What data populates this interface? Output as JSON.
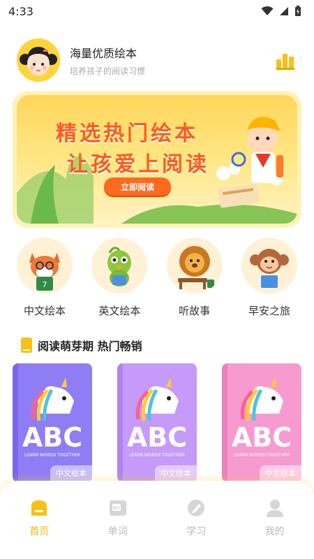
{
  "status_bar": {
    "time": "4:33"
  },
  "header": {
    "title": "海量优质绘本",
    "subtitle": "培养孩子的阅读习惯"
  },
  "banner": {
    "line1": "精选热门绘本",
    "line2": "让孩爱上阅读",
    "button": "立即阅读"
  },
  "categories": [
    {
      "label": "中文绘本",
      "icon": "fox-reading-icon"
    },
    {
      "label": "英文绘本",
      "icon": "parrot-reading-icon"
    },
    {
      "label": "听故事",
      "icon": "lion-icon"
    },
    {
      "label": "早安之旅",
      "icon": "monkey-reading-icon"
    }
  ],
  "section": {
    "title": "阅读萌芽期 热门畅销"
  },
  "books": [
    {
      "cover_text": "ABC",
      "cover_sub": "LEARN WORDS TOGETHER",
      "tag": "中文绘本",
      "color": "#8f7df5"
    },
    {
      "cover_text": "ABC",
      "cover_sub": "LEARN WORDS TOGETHER",
      "tag": "中文绘本",
      "color": "#c59af8"
    },
    {
      "cover_text": "ABC",
      "cover_sub": "LEARN WORDS TOGETHER",
      "tag": "中文绘本",
      "color": "#f79ad0"
    }
  ],
  "tabs": [
    {
      "label": "首页",
      "icon": "home-icon",
      "active": true
    },
    {
      "label": "单词",
      "icon": "word-icon"
    },
    {
      "label": "学习",
      "icon": "study-icon"
    },
    {
      "label": "我的",
      "icon": "profile-icon"
    }
  ],
  "colors": {
    "accent": "#f5b70d",
    "banner_text": "#ff5a1a",
    "button": "#ff6a1f"
  }
}
